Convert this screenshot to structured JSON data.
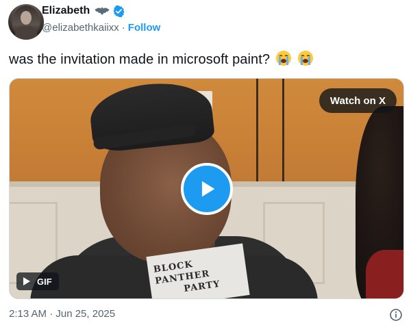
{
  "author": {
    "name": "Elizabeth",
    "handle": "@elizabethkaiixx",
    "separator": "·",
    "follow_label": "Follow",
    "badges": [
      "bat-icon",
      "verified-icon"
    ],
    "verified_color": "#1d9bf0"
  },
  "tweet": {
    "text": "was the invitation made in microsoft paint?",
    "emojis": [
      "loudly-crying-face-icon",
      "loudly-crying-face-icon"
    ]
  },
  "media": {
    "watch_label": "Watch on X",
    "gif_label": "GIF",
    "shirt_text_line1": "BLOCK PANTHER",
    "shirt_text_line2": "PARTY",
    "play_color": "#1d9bf0"
  },
  "footer": {
    "timestamp": "2:13 AM · Jun 25, 2025"
  },
  "colors": {
    "text_primary": "#0f1419",
    "text_secondary": "#536471",
    "accent": "#1d9bf0"
  }
}
